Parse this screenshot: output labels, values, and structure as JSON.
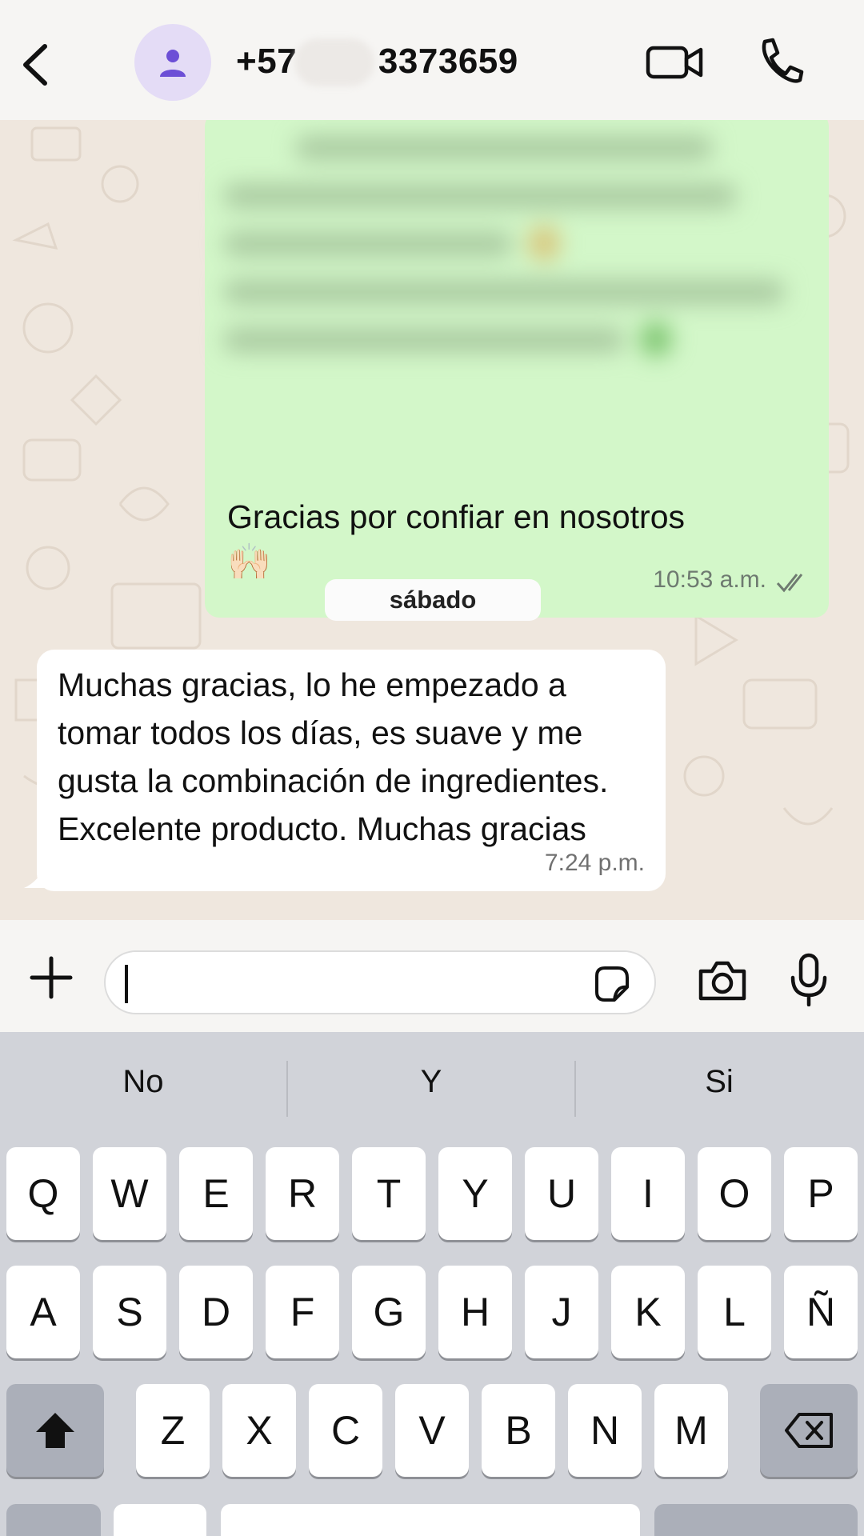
{
  "header": {
    "contact_name": "+57        3373659",
    "back_icon": "chevron-left-icon",
    "avatar_icon": "person-icon",
    "video_icon": "video-camera-icon",
    "call_icon": "phone-icon"
  },
  "messages": {
    "outgoing": {
      "text": "Gracias por confiar en nosotros",
      "emoji": "🙌🏻",
      "time": "10:53 a.m.",
      "status_icon": "double-check-icon"
    },
    "date_separator": "sábado",
    "incoming": {
      "text": "Muchas gracias, lo he empezado a tomar todos los días, es suave y me gusta la combinación de ingredientes. Excelente producto. Muchas gracias",
      "time": "7:24 p.m."
    }
  },
  "composer": {
    "input_value": "",
    "plus_icon": "plus-icon",
    "sticker_icon": "sticker-icon",
    "camera_icon": "camera-icon",
    "mic_icon": "microphone-icon"
  },
  "keyboard": {
    "suggestions": [
      "No",
      "Y",
      "Si"
    ],
    "row1": [
      "Q",
      "W",
      "E",
      "R",
      "T",
      "Y",
      "U",
      "I",
      "O",
      "P"
    ],
    "row2": [
      "A",
      "S",
      "D",
      "F",
      "G",
      "H",
      "J",
      "K",
      "L",
      "Ñ"
    ],
    "row3": [
      "Z",
      "X",
      "C",
      "V",
      "B",
      "N",
      "M"
    ],
    "shift_icon": "shift-icon",
    "backspace_icon": "backspace-icon"
  },
  "colors": {
    "outgoing_bubble": "#d3f7c9",
    "incoming_bubble": "#ffffff",
    "chat_background": "#efe7de",
    "keyboard_background": "#d1d3d9",
    "avatar_background": "#e4dcf6",
    "avatar_icon": "#6c4fd6"
  }
}
